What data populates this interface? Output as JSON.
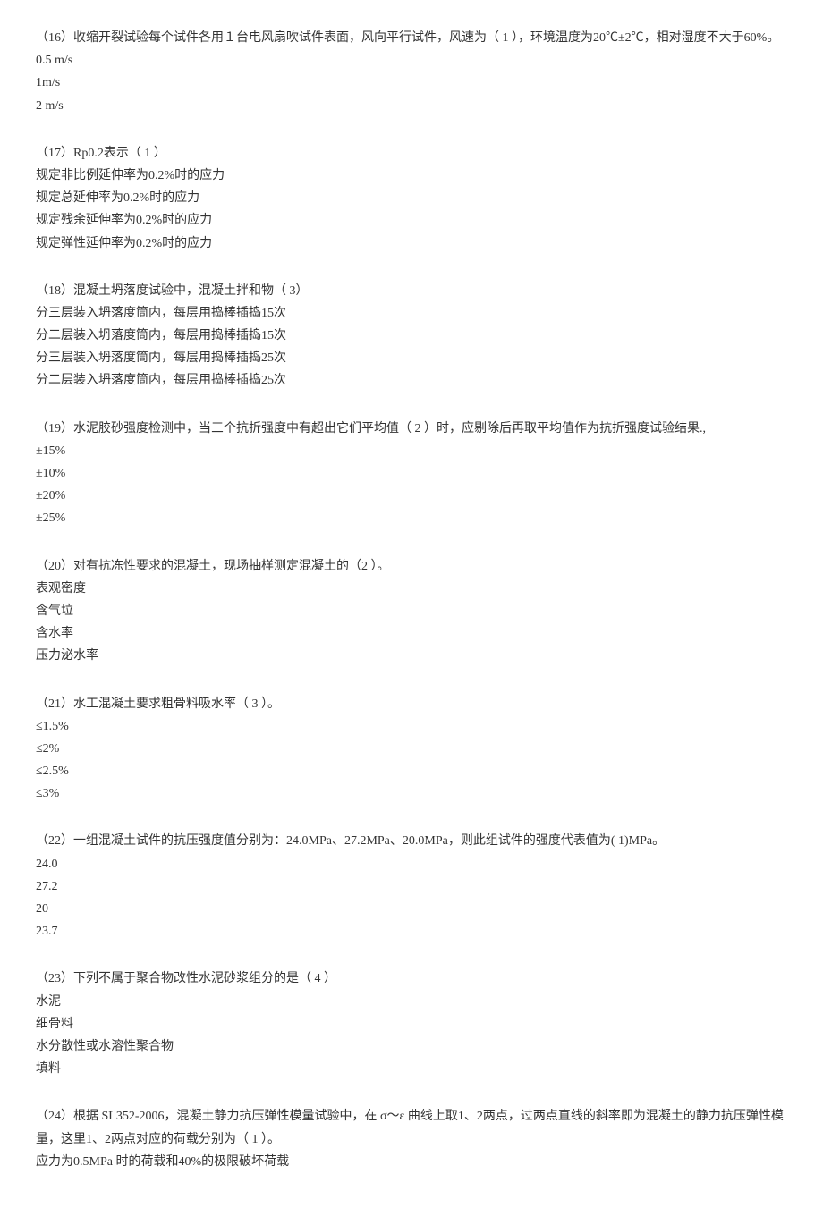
{
  "questions": [
    {
      "q": "（16）收缩开裂试验每个试件各用１台电风扇吹试件表面，风向平行试件，风速为（ 1 ），环境温度为20℃±2℃，相对湿度不大于60%。",
      "opts": [
        "0.5 m/s",
        "1m/s",
        "2 m/s"
      ]
    },
    {
      "q": "（17）Rp0.2表示（ 1 ）",
      "opts": [
        "规定非比例延伸率为0.2%时的应力",
        "规定总延伸率为0.2%时的应力",
        "规定残余延伸率为0.2%时的应力",
        "规定弹性延伸率为0.2%时的应力"
      ]
    },
    {
      "q": "（18）混凝土坍落度试验中，混凝土拌和物（ 3）",
      "opts": [
        "分三层装入坍落度筒内，每层用捣棒插捣15次",
        "分二层装入坍落度筒内，每层用捣棒插捣15次",
        "分三层装入坍落度筒内，每层用捣棒插捣25次",
        "分二层装入坍落度筒内，每层用捣棒插捣25次"
      ]
    },
    {
      "q": "（19）水泥胶砂强度检测中，当三个抗折强度中有超出它们平均值（ 2 ）时，应剔除后再取平均值作为抗折强度试验结果.,",
      "opts": [
        "±15%",
        "±10%",
        "±20%",
        "±25%"
      ]
    },
    {
      "q": "（20）对有抗冻性要求的混凝土，现场抽样测定混凝土的（2 ）。",
      "opts": [
        "表观密度",
        "含气垃",
        "含水率",
        "压力泌水率"
      ]
    },
    {
      "q": "（21）水工混凝土要求粗骨料吸水率（ 3 ）。",
      "opts": [
        "≤1.5%",
        "≤2%",
        "≤2.5%",
        "≤3%"
      ]
    },
    {
      "q": "（22）一组混凝土试件的抗压强度值分别为：24.0MPa、27.2MPa、20.0MPa，则此组试件的强度代表值为( 1)MPa。",
      "opts": [
        "24.0",
        "27.2",
        "20",
        "23.7"
      ]
    },
    {
      "q": "（23）下列不属于聚合物改性水泥砂浆组分的是（ 4 ）",
      "opts": [
        "水泥",
        "细骨料",
        "水分散性或水溶性聚合物",
        "填料"
      ]
    },
    {
      "q": "（24）根据 SL352-2006，混凝土静力抗压弹性模量试验中，在 σ～ε 曲线上取1、2两点，过两点直线的斜率即为混凝土的静力抗压弹性模量，这里1、2两点对应的荷载分别为（ 1 ）。",
      "opts": [
        "应力为0.5MPa 时的荷载和40%的极限破坏荷载"
      ]
    }
  ]
}
